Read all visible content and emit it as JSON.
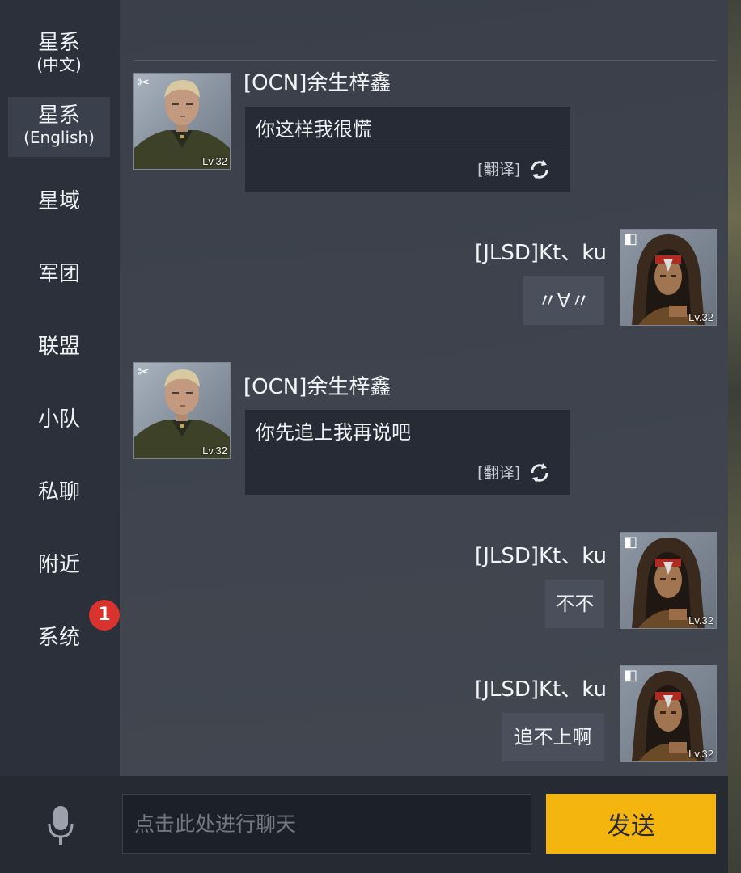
{
  "sidebar": {
    "items": [
      {
        "label": "星系",
        "sub": "(中文)"
      },
      {
        "label": "星系",
        "sub": "(English)"
      },
      {
        "label": "星域"
      },
      {
        "label": "军团"
      },
      {
        "label": "联盟"
      },
      {
        "label": "小队"
      },
      {
        "label": "私聊"
      },
      {
        "label": "附近"
      },
      {
        "label": "系统"
      }
    ],
    "active_index": 1,
    "badge_count": "1"
  },
  "messages": [
    {
      "side": "left",
      "sender": "[OCN]余生梓鑫",
      "text": "你这样我很慌",
      "translate_label": "[翻译]",
      "level": "Lv.32",
      "avatar": "officer-portrait"
    },
    {
      "side": "right",
      "sender": "[JLSD]Kt、ku",
      "text": "〃∀〃",
      "level": "Lv.32",
      "avatar": "hooded-portrait"
    },
    {
      "side": "left",
      "sender": "[OCN]余生梓鑫",
      "text": "你先追上我再说吧",
      "translate_label": "[翻译]",
      "level": "Lv.32",
      "avatar": "officer-portrait"
    },
    {
      "side": "right",
      "sender": "[JLSD]Kt、ku",
      "text": "不不",
      "level": "Lv.32",
      "avatar": "hooded-portrait"
    },
    {
      "side": "right",
      "sender": "[JLSD]Kt、ku",
      "text": "追不上啊",
      "level": "Lv.32",
      "avatar": "hooded-portrait"
    }
  ],
  "input": {
    "placeholder": "点击此处进行聊天"
  },
  "send_label": "发送",
  "colors": {
    "accent": "#f5b50f",
    "badge": "#d8332d"
  }
}
